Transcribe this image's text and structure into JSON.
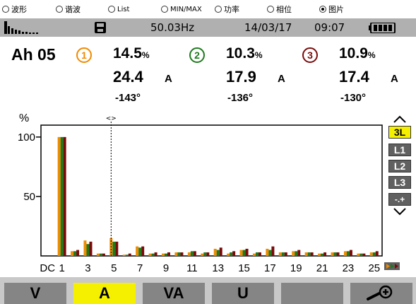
{
  "radio_bar": {
    "options": [
      {
        "label": "波形",
        "selected": false
      },
      {
        "label": "谐波",
        "selected": false
      },
      {
        "label": "List",
        "selected": false
      },
      {
        "label": "MIN/MAX",
        "selected": false
      },
      {
        "label": "功率",
        "selected": false
      },
      {
        "label": "相位",
        "selected": false
      },
      {
        "label": "图片",
        "selected": true
      }
    ]
  },
  "status": {
    "frequency": "50.03Hz",
    "date": "14/03/17",
    "time": "09:07",
    "icons": [
      "harmonic-bars-icon",
      "floppy-disk-icon",
      "battery-icon"
    ]
  },
  "measure": {
    "title": "Ah 05",
    "phases": [
      {
        "num": "1",
        "percent": "14.5",
        "percent_unit": "%",
        "current": "24.4",
        "current_unit": "A",
        "angle": "-143°",
        "color": "#f08a00"
      },
      {
        "num": "2",
        "percent": "10.3",
        "percent_unit": "%",
        "current": "17.9",
        "current_unit": "A",
        "angle": "-136°",
        "color": "#1e7a1e"
      },
      {
        "num": "3",
        "percent": "10.9",
        "percent_unit": "%",
        "current": "17.4",
        "current_unit": "A",
        "angle": "-130°",
        "color": "#7a0a0a"
      }
    ]
  },
  "side_buttons": {
    "items": [
      "3L",
      "L1",
      "L2",
      "L3",
      "-.+"
    ],
    "active": "3L"
  },
  "tabs": {
    "items": [
      "V",
      "A",
      "VA",
      "U",
      "",
      "zoom"
    ],
    "active": "A"
  },
  "colors": {
    "phase1": "#f08a00",
    "phase2": "#1e7a1e",
    "phase3": "#7a0a0a",
    "status_bg": "#b0b0b0",
    "active_yellow": "#f5f000"
  },
  "chart_data": {
    "type": "bar",
    "ylabel": "%",
    "ylim": [
      0,
      110
    ],
    "yticks": [
      50,
      100
    ],
    "tick_labels": [
      "DC",
      "1",
      "3",
      "5",
      "7",
      "9",
      "11",
      "13",
      "15",
      "17",
      "19",
      "21",
      "23",
      "25"
    ],
    "categories": [
      "DC",
      "1",
      "2",
      "3",
      "4",
      "5",
      "6",
      "7",
      "8",
      "9",
      "10",
      "11",
      "12",
      "13",
      "14",
      "15",
      "16",
      "17",
      "18",
      "19",
      "20",
      "21",
      "22",
      "23",
      "24",
      "25"
    ],
    "cursor_at": "5",
    "series": [
      {
        "values": [
          0,
          100,
          4,
          13,
          2,
          15,
          1,
          8,
          2,
          2,
          3,
          3,
          2,
          6,
          2,
          5,
          2,
          6,
          3,
          4,
          3,
          2,
          3,
          4,
          2,
          3
        ]
      },
      {
        "values": [
          0,
          100,
          4,
          10,
          2,
          12,
          1,
          7,
          2,
          2,
          3,
          4,
          3,
          5,
          3,
          5,
          3,
          5,
          3,
          4,
          3,
          2,
          3,
          4,
          2,
          3
        ]
      },
      {
        "values": [
          0,
          100,
          5,
          12,
          2,
          12,
          2,
          8,
          3,
          3,
          3,
          4,
          3,
          7,
          4,
          6,
          3,
          8,
          3,
          5,
          3,
          3,
          3,
          5,
          2,
          4
        ]
      }
    ]
  }
}
